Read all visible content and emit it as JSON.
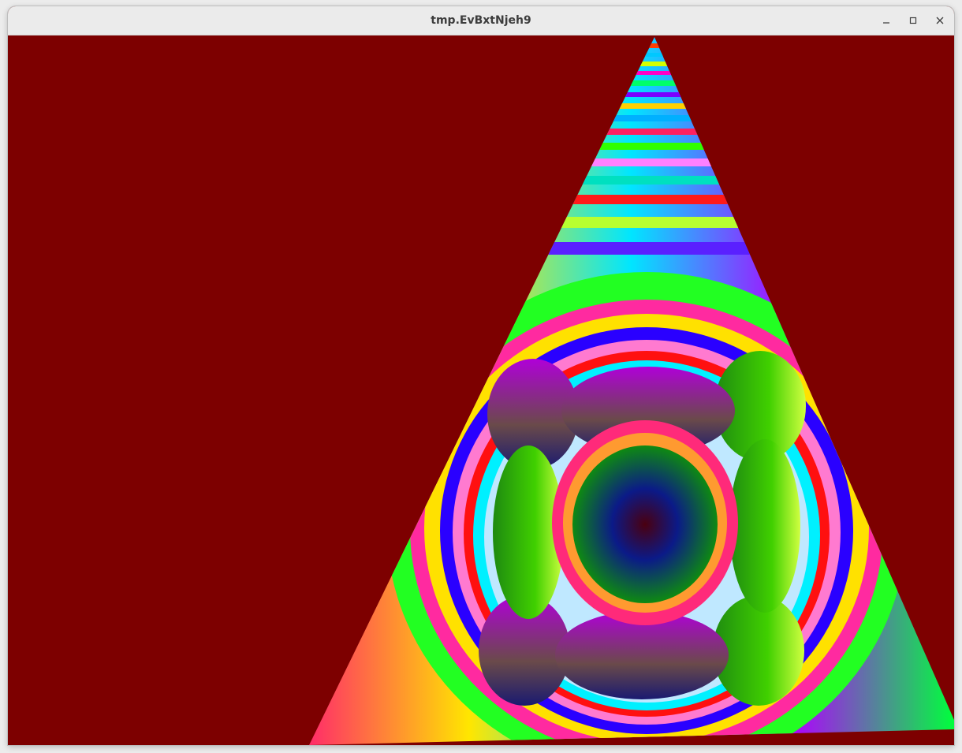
{
  "window": {
    "title": "tmp.EvBxtNjeh9",
    "controls": {
      "minimize": "minimize-icon",
      "maximize": "maximize-icon",
      "close": "close-icon"
    }
  },
  "canvas": {
    "background": "#7d0000"
  }
}
